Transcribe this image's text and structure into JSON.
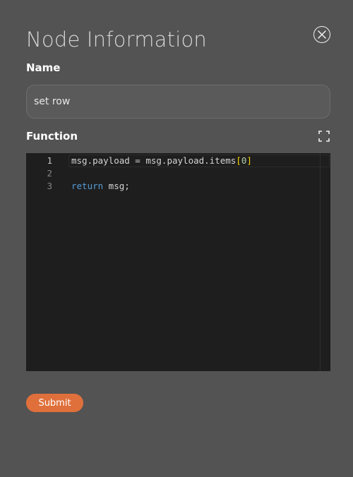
{
  "dialog": {
    "title": "Node Information",
    "close_icon": "close-circle-icon"
  },
  "name_field": {
    "label": "Name",
    "value": "set row"
  },
  "function_field": {
    "label": "Function",
    "expand_icon": "fullscreen-icon",
    "lines": [
      {
        "number": "1",
        "text": "msg.payload = msg.payload.items[0]"
      },
      {
        "number": "2",
        "text": ""
      },
      {
        "number": "3",
        "text": "return msg;"
      }
    ],
    "tokens": {
      "line1_pre": "msg.payload = msg.payload.items",
      "line1_open": "[",
      "line1_num": "0",
      "line1_close": "]",
      "line3_kw": "return",
      "line3_rest": " msg;"
    }
  },
  "actions": {
    "submit_label": "Submit"
  },
  "colors": {
    "background": "#545353",
    "accent": "#e0703b",
    "editor_bg": "#1e1e1e",
    "keyword": "#569cd6",
    "number": "#b5cea8",
    "bracket": "#ffd700"
  }
}
